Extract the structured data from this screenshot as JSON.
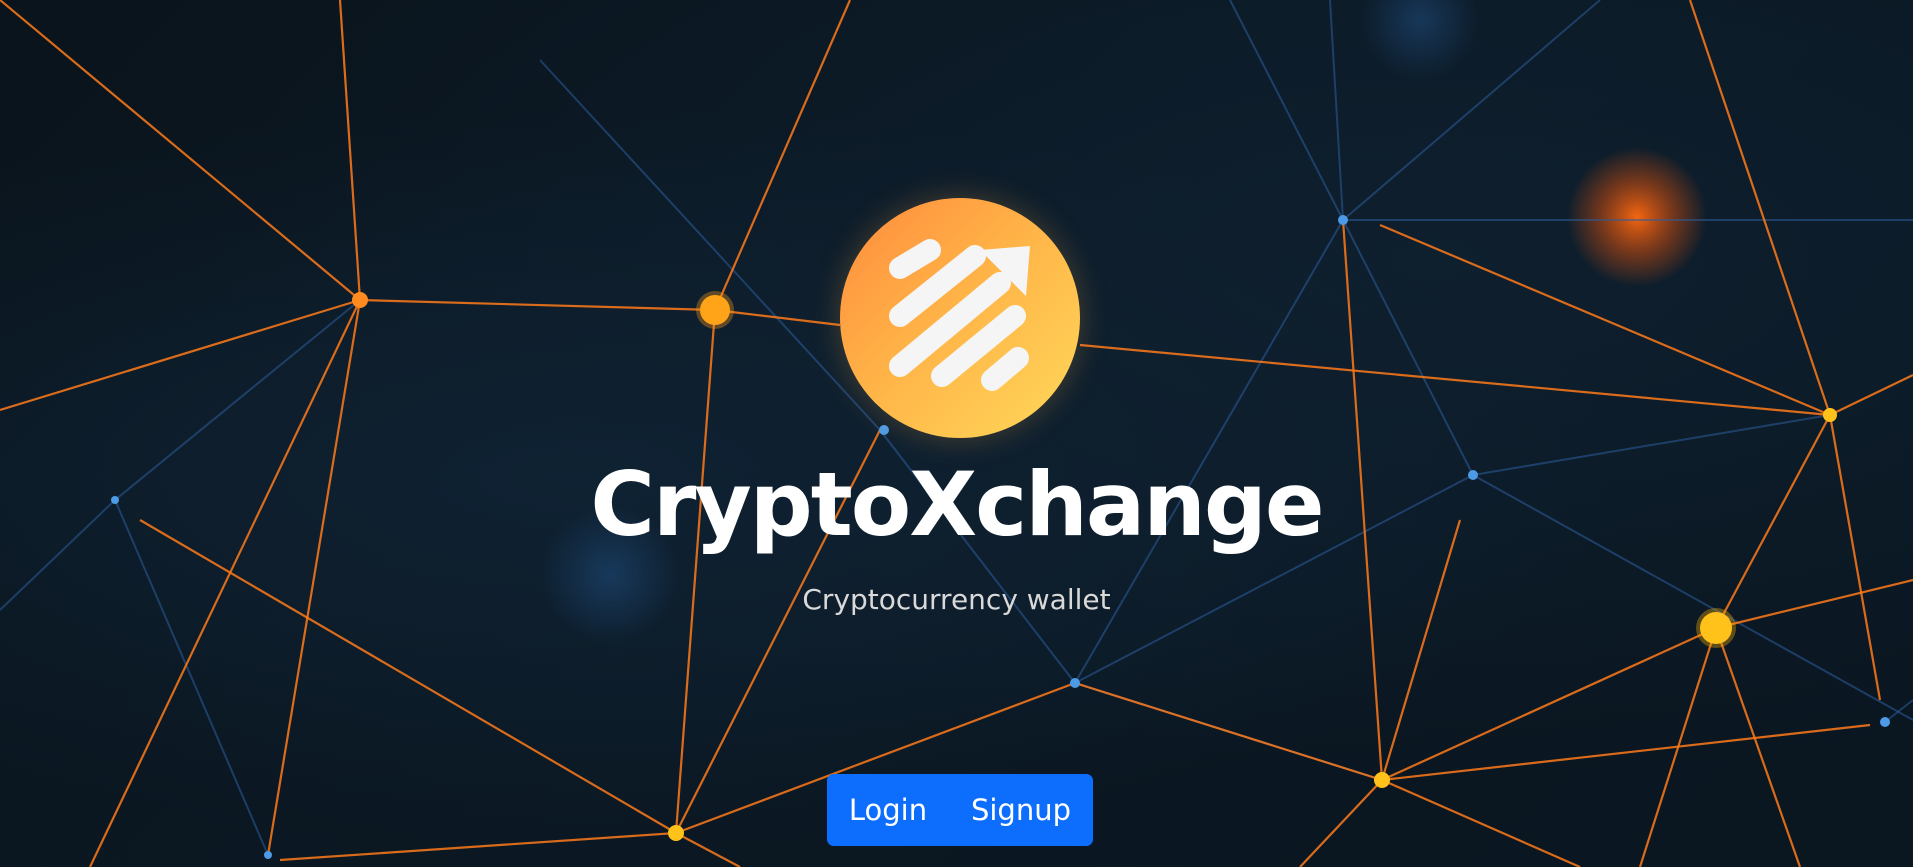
{
  "brand": {
    "name": "CryptoXchange",
    "tagline": "Cryptocurrency wallet",
    "logo_icon": "trending-up-arrow-icon",
    "logo_gradient": [
      "#ff8a3d",
      "#ffd95a"
    ]
  },
  "actions": {
    "login_label": "Login",
    "signup_label": "Signup",
    "button_color": "#0d6efd"
  },
  "background": {
    "theme": "network-constellation",
    "colors": [
      "#0b1620",
      "#ff7a1a",
      "#ffb300",
      "#2a5a9a"
    ]
  }
}
